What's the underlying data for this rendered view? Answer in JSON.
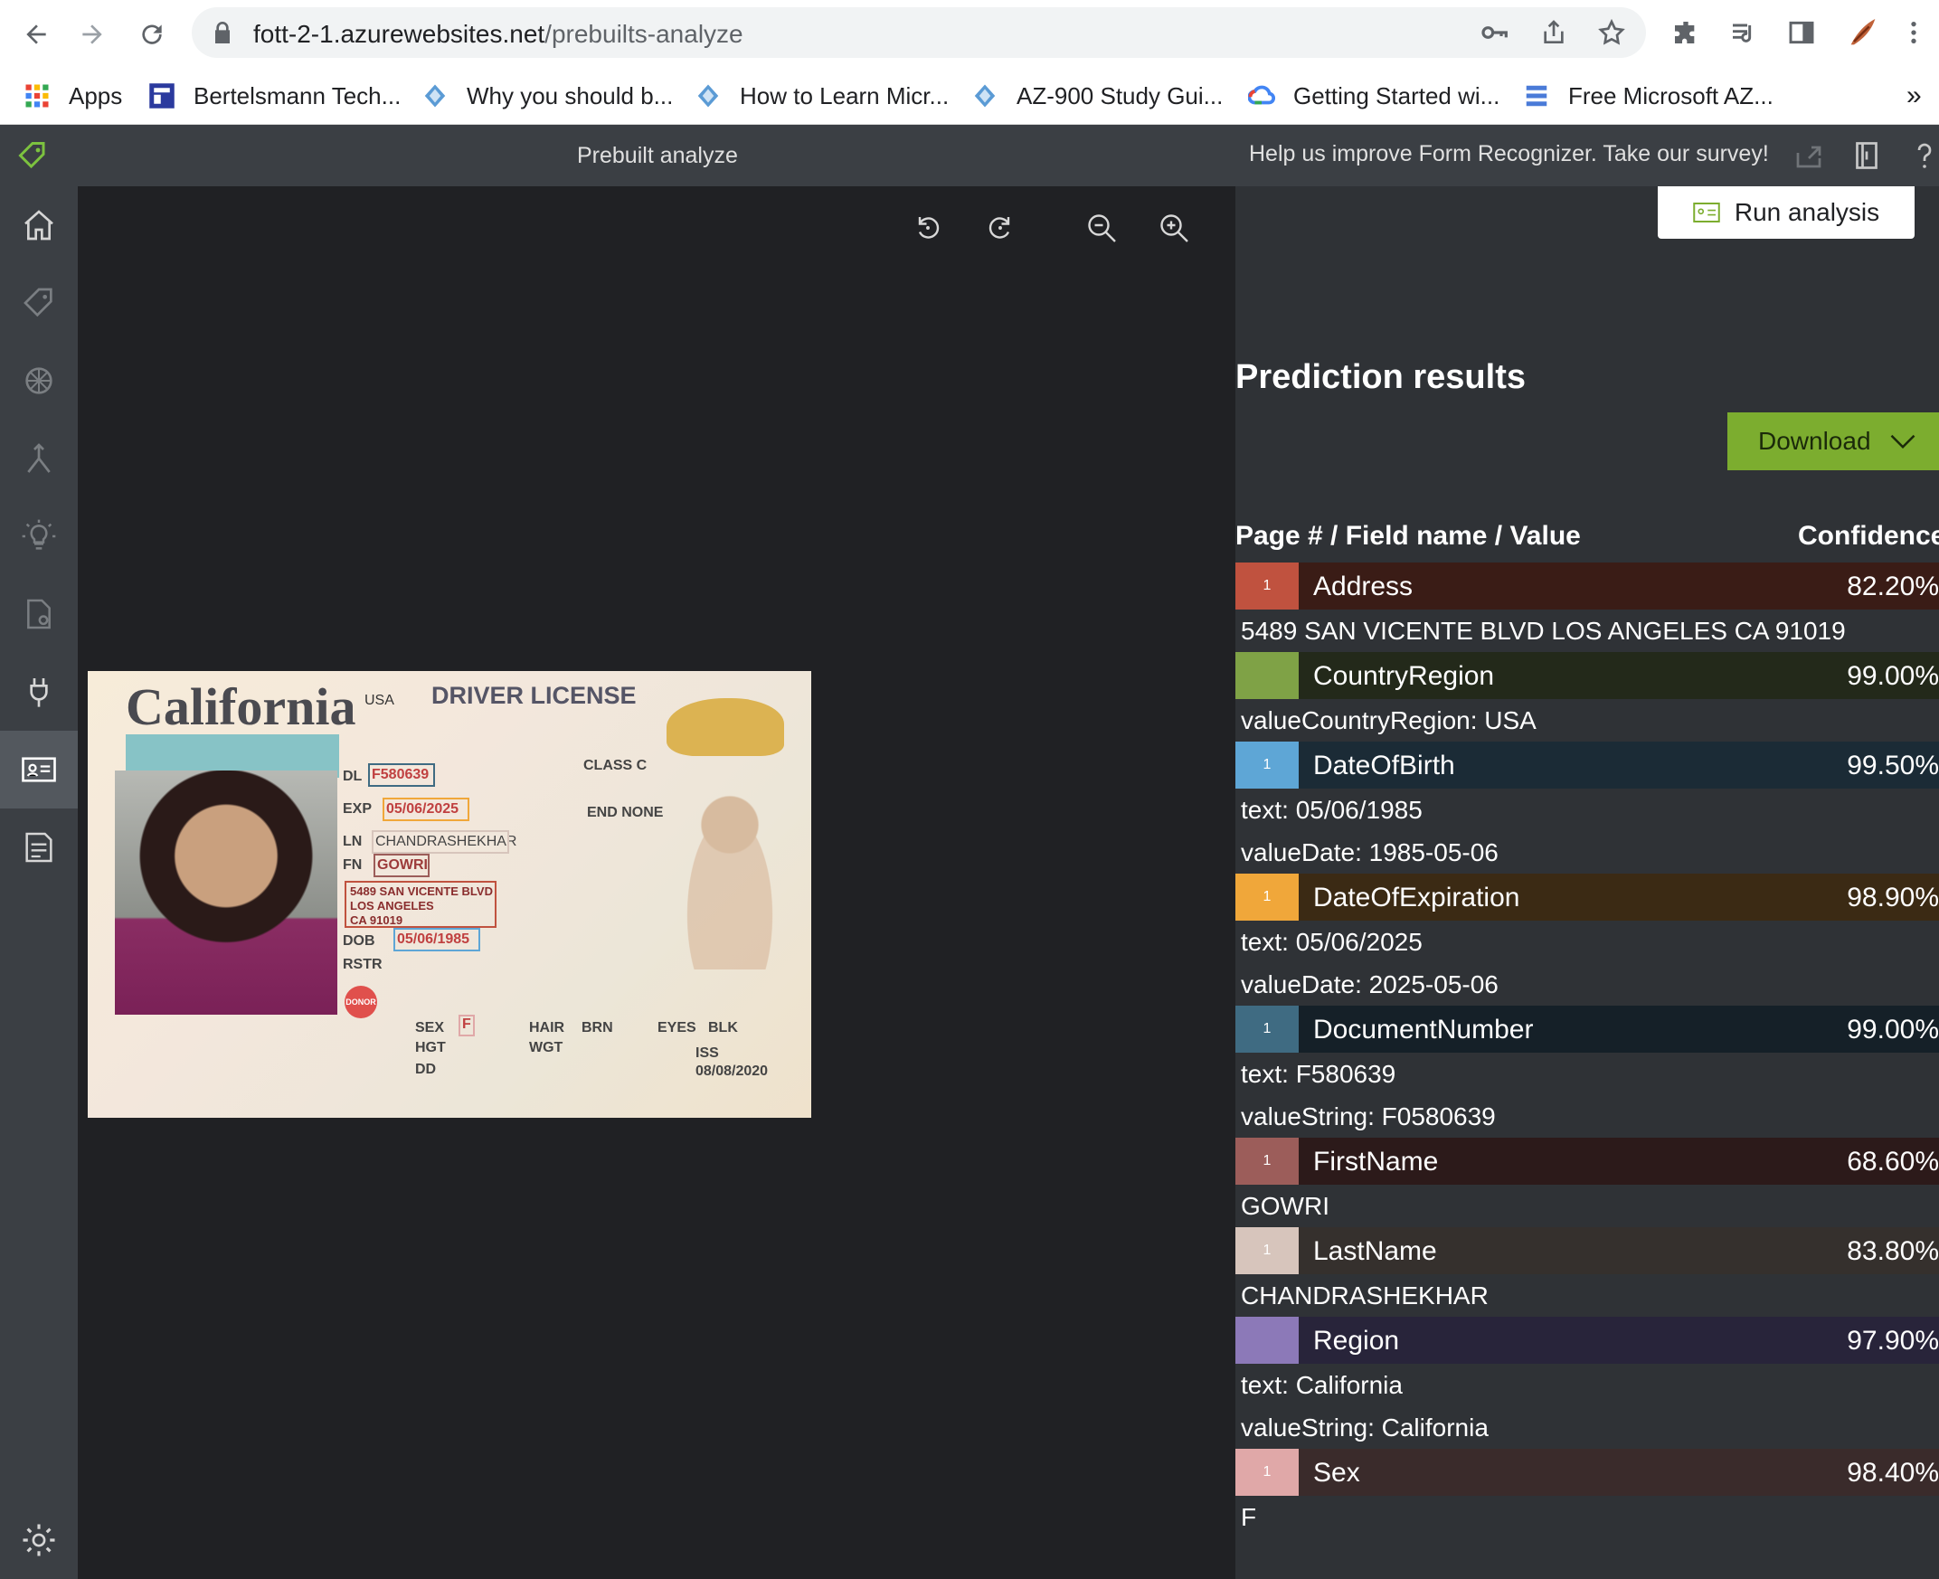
{
  "browser": {
    "url_host": "fott-2-1.azurewebsites.net",
    "url_path": "/prebuilts-analyze",
    "bookmarks": [
      {
        "label": "Apps",
        "icon": "apps-grid-icon"
      },
      {
        "label": "Bertelsmann Tech...",
        "icon": "bertelsmann-icon"
      },
      {
        "label": "Why you should b...",
        "icon": "azure-icon"
      },
      {
        "label": "How to Learn Micr...",
        "icon": "azure-icon"
      },
      {
        "label": "AZ-900 Study Gui...",
        "icon": "azure-icon"
      },
      {
        "label": "Getting Started wi...",
        "icon": "google-cloud-icon"
      },
      {
        "label": "Free Microsoft AZ...",
        "icon": "list-icon"
      }
    ],
    "overflow": "»"
  },
  "app": {
    "title": "Prebuilt analyze",
    "survey": "Help us improve Form Recognizer. Take our survey!"
  },
  "sidebar": {
    "items": [
      "home-icon",
      "tag-icon",
      "model-icon",
      "merge-icon",
      "lightbulb-icon",
      "document-settings-icon",
      "plug-icon",
      "id-card-icon",
      "receipt-icon"
    ],
    "active": "id-card-icon",
    "footer": "settings-gear-icon"
  },
  "license": {
    "state": "California",
    "country": "USA",
    "doc_type": "DRIVER LICENSE",
    "dl_label": "DL",
    "dl_number": "F580639",
    "exp_label": "EXP",
    "exp_date": "05/06/2025",
    "ln_label": "LN",
    "last_name": "CHANDRASHEKHAR",
    "fn_label": "FN",
    "first_name": "GOWRI",
    "address_line1": "5489 SAN VICENTE BLVD",
    "address_line2": "LOS ANGELES",
    "address_line3": "CA 91019",
    "dob_label": "DOB",
    "dob": "05/06/1985",
    "rstr_label": "RSTR",
    "donor": "DONOR",
    "class_label": "CLASS C",
    "end_label": "END NONE",
    "sex_label": "SEX",
    "sex": "F",
    "hgt_label": "HGT",
    "hair_label": "HAIR",
    "hair": "BRN",
    "wgt_label": "WGT",
    "eyes_label": "EYES",
    "eyes": "BLK",
    "iss_label": "ISS",
    "iss_date": "08/08/2020",
    "dd_label": "DD"
  },
  "results": {
    "run_label": "Run analysis",
    "title": "Prediction results",
    "download_label": "Download",
    "col_field": "Page # / Field name / Value",
    "col_conf": "Confidence",
    "fields": [
      {
        "page": "1",
        "name": "Address",
        "confidence": "82.20%",
        "color": "#c0523f",
        "rowbg": "#3a1c16",
        "values": [
          "5489 SAN VICENTE BLVD LOS ANGELES CA 91019"
        ]
      },
      {
        "page": "",
        "name": "CountryRegion",
        "confidence": "99.00%",
        "color": "#7fa246",
        "rowbg": "#23291a",
        "values": [
          "valueCountryRegion: USA"
        ]
      },
      {
        "page": "1",
        "name": "DateOfBirth",
        "confidence": "99.50%",
        "color": "#5ea6d6",
        "rowbg": "#1b2b36",
        "values": [
          "text: 05/06/1985",
          "valueDate: 1985-05-06"
        ]
      },
      {
        "page": "1",
        "name": "DateOfExpiration",
        "confidence": "98.90%",
        "color": "#f0a73a",
        "rowbg": "#3b2a14",
        "values": [
          "text: 05/06/2025",
          "valueDate: 2025-05-06"
        ]
      },
      {
        "page": "1",
        "name": "DocumentNumber",
        "confidence": "99.00%",
        "color": "#3f6b82",
        "rowbg": "#152028",
        "values": [
          "text: F580639",
          "valueString: F0580639"
        ]
      },
      {
        "page": "1",
        "name": "FirstName",
        "confidence": "68.60%",
        "color": "#9c5d5a",
        "rowbg": "#2c1a1a",
        "values": [
          "GOWRI"
        ]
      },
      {
        "page": "1",
        "name": "LastName",
        "confidence": "83.80%",
        "color": "#d7c5bc",
        "rowbg": "#35302d",
        "values": [
          "CHANDRASHEKHAR"
        ]
      },
      {
        "page": "",
        "name": "Region",
        "confidence": "97.90%",
        "color": "#8c79b8",
        "rowbg": "#28243a",
        "values": [
          "text: California",
          "valueString: California"
        ]
      },
      {
        "page": "1",
        "name": "Sex",
        "confidence": "98.40%",
        "color": "#e0a8a8",
        "rowbg": "#3a2b2b",
        "values": [
          "F"
        ]
      }
    ]
  }
}
